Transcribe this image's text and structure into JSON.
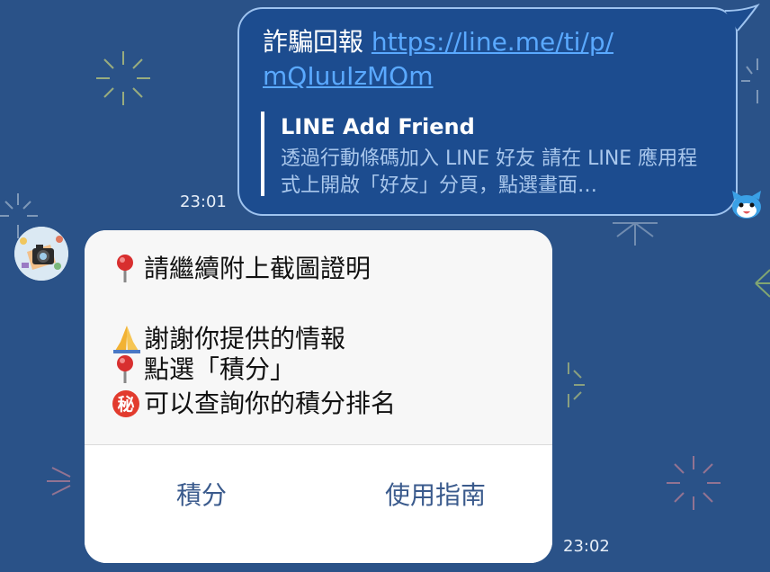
{
  "outgoing": {
    "prefix": "詐騙回報 ",
    "link_line1": "https://line.me/ti/p/",
    "link_line2": "mQIuuIzMOm",
    "preview_title": "LINE Add Friend",
    "preview_desc": "透過行動條碼加入 LINE 好友 請在 LINE 應用程式上開啟「好友」分頁，點選畫面…",
    "time": "23:01"
  },
  "incoming": {
    "line1": "請繼續附上截圖證明",
    "line2": "謝謝你提供的情報",
    "line3": "點選「積分」",
    "line4": "可以查詢你的積分排名",
    "secret_badge": "秘",
    "time": "23:02",
    "actions": [
      "積分",
      "使用指南"
    ]
  },
  "colors": {
    "background": "#2a5288",
    "outgoing_bubble": "#1c4c8f",
    "link": "#5aa9ff",
    "action_text": "#3a5a8c"
  },
  "icons": [
    "pin-icon",
    "praying-hands-icon",
    "secret-badge-icon",
    "avatar-camera",
    "mascot-face-icon"
  ]
}
